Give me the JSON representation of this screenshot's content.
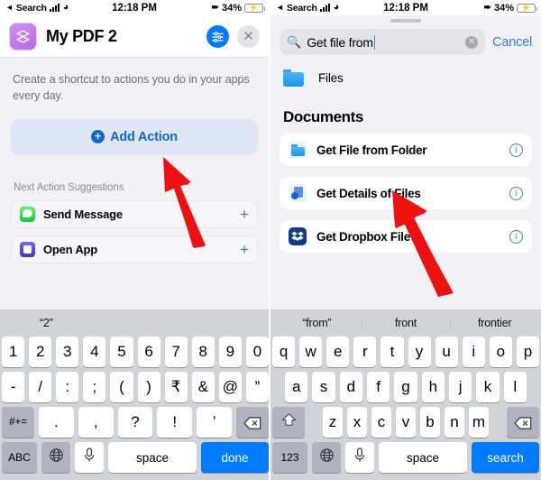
{
  "status_bar": {
    "back_label": "Search",
    "time": "12:18 PM",
    "battery_percent": "34%",
    "signal_icon": "cellular-bars-icon",
    "wifi_icon": "wifi-icon",
    "location_icon": "location-arrow-icon",
    "battery_icon": "battery-charging-icon"
  },
  "left": {
    "header": {
      "app_icon": "shortcuts-app-icon",
      "title": "My PDF 2",
      "settings_icon": "sliders-icon",
      "close_icon": "close-x-icon"
    },
    "intro_text": "Create a shortcut to actions you do in your apps every day.",
    "add_action": {
      "label": "Add Action",
      "icon": "plus-circle-icon"
    },
    "suggestions_label": "Next Action Suggestions",
    "suggestions": [
      {
        "name": "Send Message",
        "icon": "messages-app-icon",
        "add_icon": "plus-icon"
      },
      {
        "name": "Open App",
        "icon": "open-app-icon",
        "add_icon": "plus-icon"
      }
    ],
    "keyboard": {
      "predictions": [
        "“2”",
        "",
        ""
      ],
      "row1": [
        "1",
        "2",
        "3",
        "4",
        "5",
        "6",
        "7",
        "8",
        "9",
        "0"
      ],
      "row2": [
        "-",
        "/",
        ":",
        ";",
        "(",
        ")",
        "₹",
        "&",
        "@",
        "”"
      ],
      "row3_fn": "#+=",
      "row3": [
        ".",
        ",",
        "?",
        "!",
        "’"
      ],
      "row3_backspace": "backspace-icon",
      "row4_abc": "ABC",
      "row4_globe": "globe-icon",
      "row4_mic": "microphone-icon",
      "row4_space": "space",
      "row4_action": "done"
    }
  },
  "right": {
    "search": {
      "value": "Get file from",
      "search_icon": "search-icon",
      "clear_icon": "clear-circle-icon",
      "cancel_label": "Cancel"
    },
    "files_row": {
      "label": "Files",
      "icon": "folder-icon"
    },
    "section_title": "Documents",
    "results": [
      {
        "name": "Get File from Folder",
        "icon": "folder-icon",
        "info_icon": "info-icon"
      },
      {
        "name": "Get Details of Files",
        "icon": "file-details-icon",
        "info_icon": "info-icon"
      },
      {
        "name": "Get Dropbox File",
        "icon": "dropbox-icon",
        "info_icon": "info-icon"
      }
    ],
    "keyboard": {
      "predictions": [
        "“from”",
        "front",
        "frontier"
      ],
      "row1": [
        "q",
        "w",
        "e",
        "r",
        "t",
        "y",
        "u",
        "i",
        "o",
        "p"
      ],
      "row2": [
        "a",
        "s",
        "d",
        "f",
        "g",
        "h",
        "j",
        "k",
        "l"
      ],
      "row3_shift": "shift-icon",
      "row3": [
        "z",
        "x",
        "c",
        "v",
        "b",
        "n",
        "m"
      ],
      "row3_backspace": "backspace-icon",
      "row4_numbers": "123",
      "row4_globe": "globe-icon",
      "row4_mic": "microphone-icon",
      "row4_space": "space",
      "row4_action": "search"
    }
  },
  "annotations": {
    "arrow_color": "#ee1111",
    "arrow_left": "pointer-arrow-to-add-action",
    "arrow_right": "pointer-arrow-to-get-file-from-folder"
  }
}
